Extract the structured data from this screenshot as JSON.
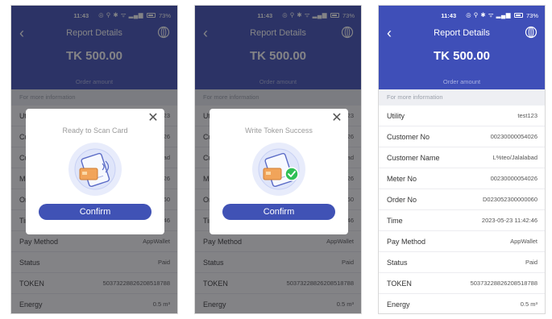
{
  "status_bar": {
    "time": "11:43",
    "battery": "73%"
  },
  "header": {
    "title": "Report Details",
    "amount": "TK 500.00",
    "amount_label": "Order amount"
  },
  "section_label": "For more information",
  "rows": [
    {
      "label": "Utility",
      "value": "test123"
    },
    {
      "label": "Customer No",
      "value": "00230000054026"
    },
    {
      "label": "Customer Name",
      "value": "L%teo/Jalalabad"
    },
    {
      "label": "Meter No",
      "value": "00230000054026"
    },
    {
      "label": "Order No",
      "value": "D023052300000060"
    },
    {
      "label": "Time",
      "value": "2023-05-23 11:42:46"
    },
    {
      "label": "Pay Method",
      "value": "AppWallet"
    },
    {
      "label": "Status",
      "value": "Paid"
    },
    {
      "label": "TOKEN",
      "value": "50373228826208518788"
    },
    {
      "label": "Energy",
      "value": "0.5 m³"
    }
  ],
  "dialog_1": {
    "message": "Ready to Scan Card",
    "confirm_label": "Confirm"
  },
  "dialog_2": {
    "message": "Write Token Success",
    "confirm_label": "Confirm"
  },
  "colors": {
    "primary": "#3f4fb8",
    "success": "#2fbf55"
  }
}
